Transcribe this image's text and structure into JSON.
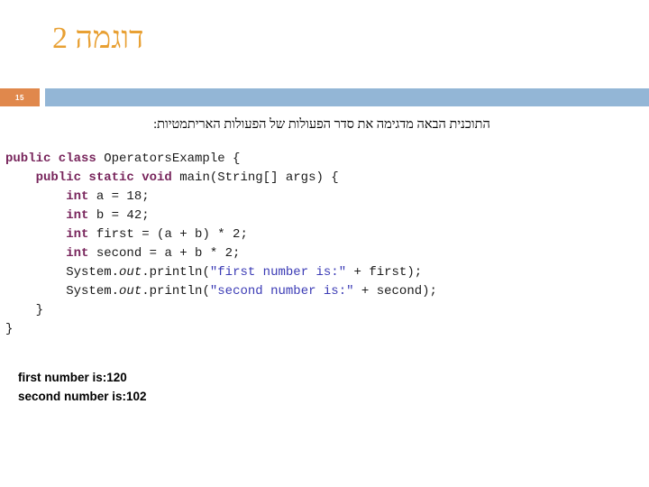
{
  "slide": {
    "title": "דוגמה 2",
    "number_badge": "15",
    "subtitle": "התוכנית הבאה מדגימה את סדר הפעולות של הפעולות האריתמטיות:",
    "colors": {
      "title_orange": "#E8A033",
      "badge_orange": "#E0884C",
      "divider_blue": "#93B6D6",
      "keyword_purple": "#78255C",
      "string_blue": "#3B3BB5",
      "text_black": "#000000"
    }
  },
  "code": {
    "language": "java",
    "class_name": "OperatorsExample",
    "lines": [
      {
        "indent": "",
        "parts": [
          {
            "text": "public class ",
            "style": "keyword"
          },
          {
            "text": "OperatorsExample {",
            "style": "plain"
          }
        ]
      },
      {
        "indent": "    ",
        "parts": [
          {
            "text": "public static void ",
            "style": "keyword"
          },
          {
            "text": "main(String[] args) {",
            "style": "plain"
          }
        ]
      },
      {
        "indent": "        ",
        "parts": [
          {
            "text": "int ",
            "style": "keyword"
          },
          {
            "text": "a = 18;",
            "style": "plain"
          }
        ]
      },
      {
        "indent": "        ",
        "parts": [
          {
            "text": "int ",
            "style": "keyword"
          },
          {
            "text": "b = 42;",
            "style": "plain"
          }
        ]
      },
      {
        "indent": "        ",
        "parts": [
          {
            "text": "int ",
            "style": "keyword"
          },
          {
            "text": "first = (a + b) * 2;",
            "style": "plain"
          }
        ]
      },
      {
        "indent": "        ",
        "parts": [
          {
            "text": "int ",
            "style": "keyword"
          },
          {
            "text": "second = a + b * 2;",
            "style": "plain"
          }
        ]
      },
      {
        "indent": "        ",
        "parts": [
          {
            "text": "System.",
            "style": "plain"
          },
          {
            "text": "out",
            "style": "italic"
          },
          {
            "text": ".println(",
            "style": "plain"
          },
          {
            "text": "\"first number is:\"",
            "style": "string"
          },
          {
            "text": " + first);",
            "style": "plain"
          }
        ]
      },
      {
        "indent": "        ",
        "parts": [
          {
            "text": "System.",
            "style": "plain"
          },
          {
            "text": "out",
            "style": "italic"
          },
          {
            "text": ".println(",
            "style": "plain"
          },
          {
            "text": "\"second number is:\"",
            "style": "string"
          },
          {
            "text": " + second);",
            "style": "plain"
          }
        ]
      },
      {
        "indent": "    ",
        "parts": [
          {
            "text": "}",
            "style": "plain"
          }
        ]
      },
      {
        "indent": "",
        "parts": [
          {
            "text": "}",
            "style": "plain"
          }
        ]
      }
    ]
  },
  "output": {
    "lines": [
      "first number is:120",
      "second number is:102"
    ]
  }
}
